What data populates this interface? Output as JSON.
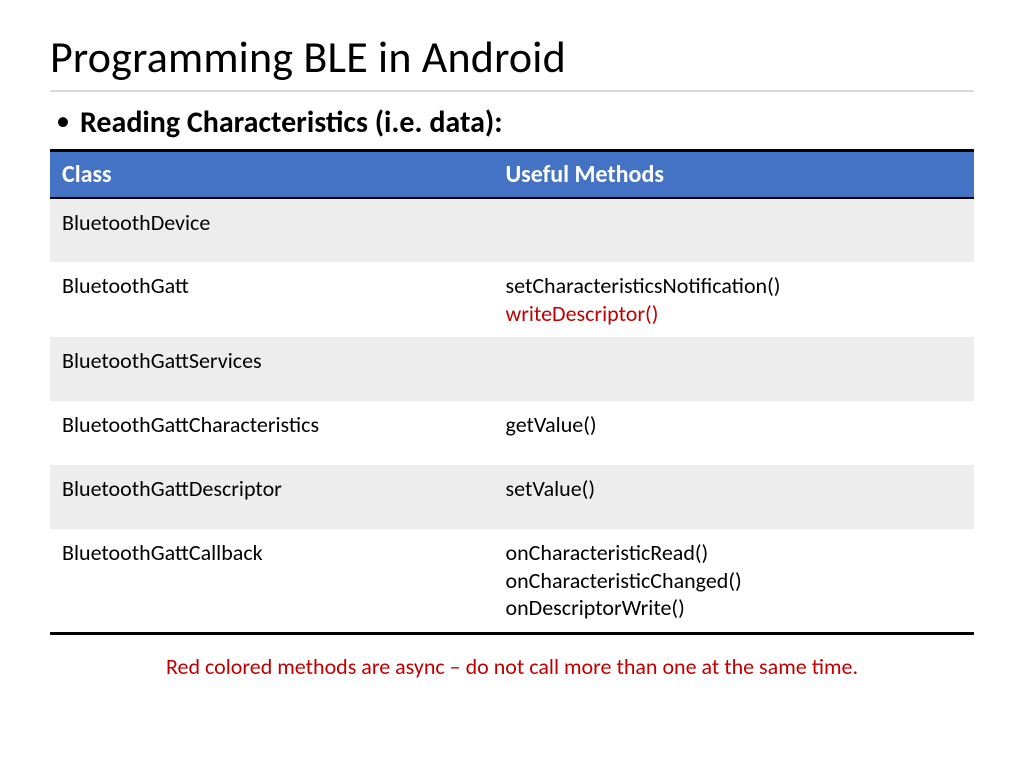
{
  "title": "Programming BLE in Android",
  "bullet": "Reading Characteristics (i.e. data):",
  "headers": {
    "class": "Class",
    "methods": "Useful Methods"
  },
  "rows": [
    {
      "class": "BluetoothDevice",
      "methods": []
    },
    {
      "class": "BluetoothGatt",
      "methods": [
        {
          "text": "setCharacteristicsNotification()",
          "red": false
        },
        {
          "text": "writeDescriptor()",
          "red": true
        }
      ]
    },
    {
      "class": "BluetoothGattServices",
      "methods": []
    },
    {
      "class": "BluetoothGattCharacteristics",
      "methods": [
        {
          "text": "getValue()",
          "red": false
        }
      ]
    },
    {
      "class": "BluetoothGattDescriptor",
      "methods": [
        {
          "text": "setValue()",
          "red": false
        }
      ]
    },
    {
      "class": "BluetoothGattCallback",
      "methods": [
        {
          "text": "onCharacteristicRead()",
          "red": false
        },
        {
          "text": "onCharacteristicChanged()",
          "red": false
        },
        {
          "text": "onDescriptorWrite()",
          "red": false
        }
      ]
    }
  ],
  "footnote": "Red colored methods are async – do not call more than one at the same time."
}
